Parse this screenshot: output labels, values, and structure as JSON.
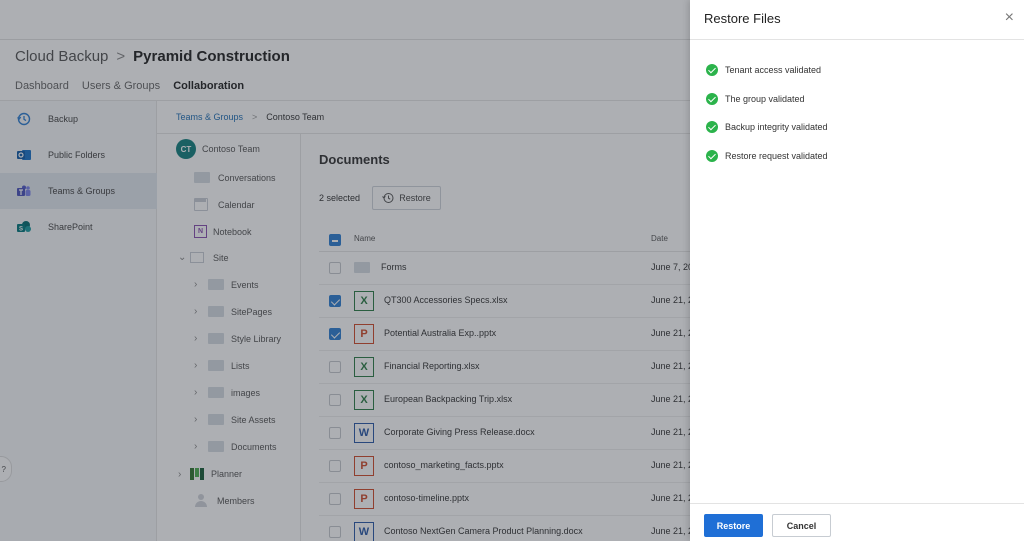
{
  "header": {
    "app_title": "Cloud Backup",
    "separator": ">",
    "org_name": "Pyramid Construction"
  },
  "main_nav": [
    {
      "label": "Dashboard"
    },
    {
      "label": "Users & Groups"
    },
    {
      "label": "Collaboration",
      "active": true
    }
  ],
  "sidebar": {
    "items": [
      {
        "label": "Backup",
        "icon": "history-icon"
      },
      {
        "label": "Public Folders",
        "icon": "outlook-icon"
      },
      {
        "label": "Teams & Groups",
        "icon": "teams-icon",
        "selected": true
      },
      {
        "label": "SharePoint",
        "icon": "sharepoint-icon"
      }
    ]
  },
  "breadcrumb": {
    "link": "Teams & Groups",
    "separator": ">",
    "current": "Contoso Team"
  },
  "tree": {
    "team_initials": "CT",
    "team_name": "Contoso Team",
    "conversations": "Conversations",
    "calendar": "Calendar",
    "notebook": "Notebook",
    "notebook_icon_letter": "N",
    "site": "Site",
    "site_children": [
      "Events",
      "SitePages",
      "Style Library",
      "Lists",
      "images",
      "Site Assets",
      "Documents"
    ],
    "planner": "Planner",
    "members": "Members"
  },
  "documents": {
    "title": "Documents",
    "selected_text": "2 selected",
    "restore_label": "Restore",
    "col_name": "Name",
    "col_date": "Date",
    "rows": [
      {
        "type": "folder",
        "name": "Forms",
        "date": "June 7, 20",
        "checked": false
      },
      {
        "type": "x",
        "letter": "X",
        "name": "QT300 Accessories Specs.xlsx",
        "date": "June 21, 2",
        "checked": true
      },
      {
        "type": "p",
        "letter": "P",
        "name": "Potential Australia Exp..pptx",
        "date": "June 21, 2",
        "checked": true
      },
      {
        "type": "x",
        "letter": "X",
        "name": "Financial Reporting.xlsx",
        "date": "June 21, 2",
        "checked": false
      },
      {
        "type": "x",
        "letter": "X",
        "name": "European Backpacking Trip.xlsx",
        "date": "June 21, 2",
        "checked": false
      },
      {
        "type": "w",
        "letter": "W",
        "name": "Corporate Giving Press Release.docx",
        "date": "June 21, 2",
        "checked": false
      },
      {
        "type": "p",
        "letter": "P",
        "name": "contoso_marketing_facts.pptx",
        "date": "June 21, 2",
        "checked": false
      },
      {
        "type": "p",
        "letter": "P",
        "name": "contoso-timeline.pptx",
        "date": "June 21, 2",
        "checked": false
      },
      {
        "type": "w",
        "letter": "W",
        "name": "Contoso NextGen Camera Product Planning.docx",
        "date": "June 21, 2",
        "checked": false
      }
    ]
  },
  "help_label": "?",
  "panel": {
    "title": "Restore Files",
    "close_glyph": "×",
    "checks": [
      "Tenant access validated",
      "The group validated",
      "Backup integrity validated",
      "Restore request validated"
    ],
    "restore_button": "Restore",
    "cancel_button": "Cancel"
  }
}
